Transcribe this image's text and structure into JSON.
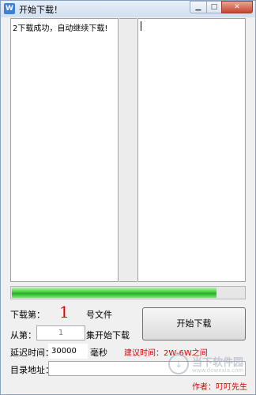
{
  "window": {
    "title": "开始下载！",
    "icon": "app-logo-icon",
    "icon_glyph": "W",
    "controls": {
      "minimize": "▁",
      "maximize": "□",
      "close": "✕"
    }
  },
  "log": {
    "left_text": "2下载成功，自动继续下载!",
    "right_text": ""
  },
  "progress": {
    "fraction": 0.88
  },
  "form": {
    "download_label": "下载第：",
    "download_number": "1",
    "file_suffix": "号文件",
    "from_label": "从第：",
    "from_value": "1",
    "from_suffix": "集开始下载",
    "delay_label": "延迟时间：",
    "delay_value": "30000",
    "delay_unit": "毫秒",
    "delay_hint": "建议时间：2W-6W之间",
    "dir_label": "目录地址：",
    "dir_value": "",
    "author": "作者：叮叮先生"
  },
  "start_button": {
    "label": "开始下载"
  },
  "watermark": {
    "glyph": "↓",
    "text": "当下软件园",
    "sub": "www.downxia.com"
  },
  "colors": {
    "accent_red": "#e00000",
    "progress_green": "#21b121"
  }
}
